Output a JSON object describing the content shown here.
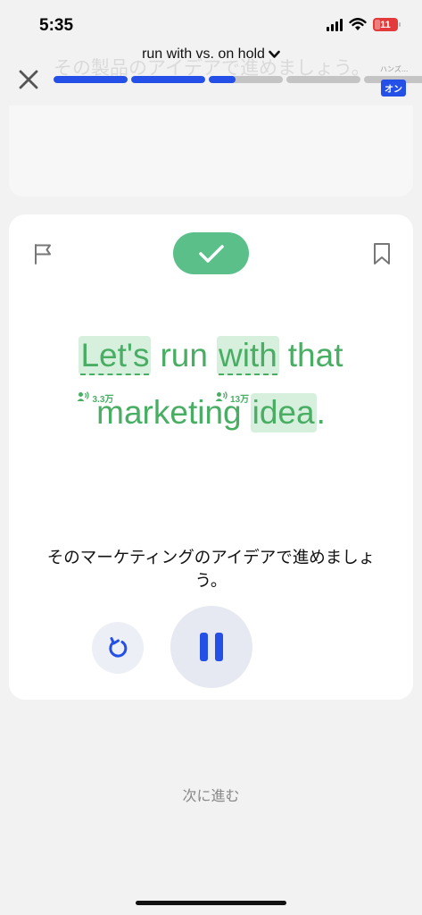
{
  "status_bar": {
    "time": "5:35",
    "battery": "11",
    "icons": [
      "signal-icon",
      "wifi-icon",
      "battery-icon"
    ]
  },
  "header": {
    "ghost_sentence": "その製品のアイデアで進めましょう。",
    "lesson_title": "run with vs. on hold",
    "close_icon": "close-icon",
    "progress": [
      1.0,
      1.0,
      0.36,
      0.0,
      0.0
    ],
    "handsfree_label": "ハンズ...",
    "handsfree_toggle": "オン"
  },
  "card": {
    "status_icon": "check-icon",
    "sentence_line1": [
      {
        "text": "Let's",
        "highlight": true,
        "dotted": true,
        "freq": "3.3万"
      },
      {
        "text": "run",
        "highlight": false,
        "dotted": false
      },
      {
        "text": "with",
        "highlight": true,
        "dotted": true,
        "freq": "13万"
      },
      {
        "text": "that",
        "highlight": false,
        "dotted": false
      }
    ],
    "sentence_line2": [
      {
        "text": "marketing",
        "highlight": false,
        "dotted": false
      },
      {
        "text": "idea",
        "highlight": true,
        "dotted": false
      },
      {
        "text": ".",
        "highlight": false,
        "dotted": false
      }
    ],
    "translation": "そのマーケティングのアイデアで進めましょう。"
  },
  "controls": {
    "replay_icon": "replay-icon",
    "pause_icon": "pause-icon"
  },
  "footer": {
    "next_label": "次に進む"
  },
  "colors": {
    "accent_blue": "#2450e8",
    "green_text": "#49ae64",
    "green_badge": "#5bbf8a",
    "highlight_bg": "#d7f0de"
  }
}
